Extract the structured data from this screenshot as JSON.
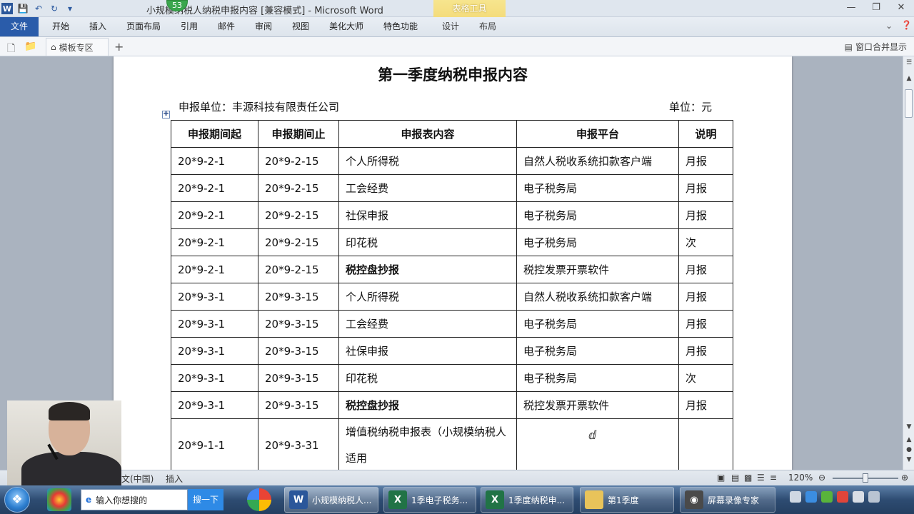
{
  "window": {
    "title": "小规模纳税人纳税申报内容 [兼容模式] - Microsoft Word",
    "badge": "53",
    "contextual_group": "表格工具"
  },
  "ribbon": {
    "tabs": [
      "文件",
      "开始",
      "插入",
      "页面布局",
      "引用",
      "邮件",
      "审阅",
      "视图",
      "美化大师",
      "特色功能",
      "设计",
      "布局"
    ]
  },
  "filebar": {
    "templates_tab": "模板专区",
    "merge_windows": "窗口合并显示"
  },
  "document": {
    "title": "第一季度纳税申报内容",
    "unit_left": "申报单位：丰源科技有限责任公司",
    "unit_right": "单位：元",
    "headers": [
      "申报期间起",
      "申报期间止",
      "申报表内容",
      "申报平台",
      "说明"
    ],
    "rows": [
      [
        "20*9-2-1",
        "20*9-2-15",
        "个人所得税",
        "自然人税收系统扣款客户端",
        "月报"
      ],
      [
        "20*9-2-1",
        "20*9-2-15",
        "工会经费",
        "电子税务局",
        "月报"
      ],
      [
        "20*9-2-1",
        "20*9-2-15",
        "社保申报",
        "电子税务局",
        "月报"
      ],
      [
        "20*9-2-1",
        "20*9-2-15",
        "印花税",
        "电子税务局",
        "次"
      ],
      [
        "20*9-2-1",
        "20*9-2-15",
        "税控盘抄报",
        "税控发票开票软件",
        "月报"
      ],
      [
        "20*9-3-1",
        "20*9-3-15",
        "个人所得税",
        "自然人税收系统扣款客户端",
        "月报"
      ],
      [
        "20*9-3-1",
        "20*9-3-15",
        "工会经费",
        "电子税务局",
        "月报"
      ],
      [
        "20*9-3-1",
        "20*9-3-15",
        "社保申报",
        "电子税务局",
        "月报"
      ],
      [
        "20*9-3-1",
        "20*9-3-15",
        "印花税",
        "电子税务局",
        "次"
      ],
      [
        "20*9-3-1",
        "20*9-3-15",
        "税控盘抄报",
        "税控发票开票软件",
        "月报"
      ],
      [
        "20*9-1-1",
        "20*9-3-31",
        "增值税纳税申报表（小规模纳税人适用",
        "",
        ""
      ]
    ]
  },
  "statusbar": {
    "language": "文(中国)",
    "mode": "插入",
    "zoom": "120%"
  },
  "taskbar": {
    "search_placeholder": "输入你想搜的",
    "search_button": "搜一下",
    "tasks": [
      "小规模纳税人...",
      "1季电子税务...",
      "1季度纳税申...",
      "第1季度",
      "屏幕录像专家"
    ]
  },
  "colors": {
    "file_tab": "#2a5caa",
    "contextual_tab": "#f4dc7c",
    "page_background": "#aab3bf"
  }
}
